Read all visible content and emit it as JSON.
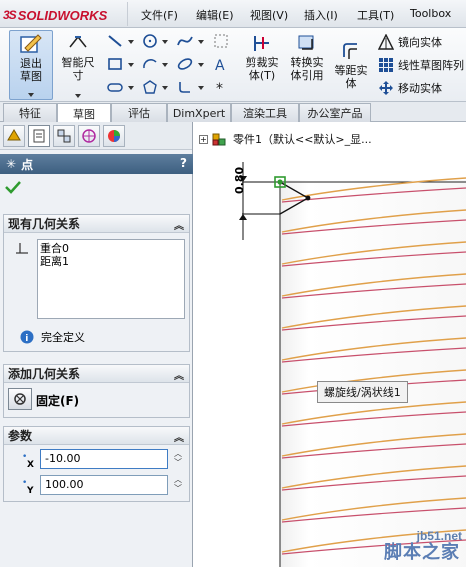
{
  "app": {
    "logo_prefix": "3S",
    "logo_name": "SOLIDWORKS"
  },
  "menu": [
    "文件(F)",
    "编辑(E)",
    "视图(V)",
    "插入(I)",
    "工具(T)",
    "Toolbox"
  ],
  "ribbon": {
    "exit_sketch": "退出草图",
    "smart_dim": "智能尺寸",
    "trim": "剪裁实体(T)",
    "convert": "转换实体引用",
    "offset": "等距实体",
    "mirror": "镜向实体",
    "linear_pattern": "线性草图阵列",
    "move": "移动实体"
  },
  "tabs": [
    "特征",
    "草图",
    "评估",
    "DimXpert",
    "渲染工具",
    "办公室产品"
  ],
  "active_tab": "草图",
  "panel": {
    "title": "点",
    "help": "?",
    "existing_relations_header": "现有几何关系",
    "relations": [
      "重合0",
      "距离1"
    ],
    "status": "完全定义",
    "add_relations_header": "添加几何关系",
    "fixed_label": "固定(F)",
    "params_header": "参数",
    "x_label": "X",
    "y_label": "Y",
    "x_value": "-10.00",
    "y_value": "100.00"
  },
  "graphics": {
    "tree_label": "零件1（默认<<默认>_显...",
    "dimension": "0.80",
    "tooltip": "螺旋线/涡状线1",
    "watermark_url": "jb51.net",
    "watermark_cn": "脚本之家"
  },
  "colors": {
    "helix_a": "#e0a04a",
    "helix_b": "#c8506c",
    "title_bar": "#4a6b8c",
    "ok_green": "#2f9b2f"
  }
}
